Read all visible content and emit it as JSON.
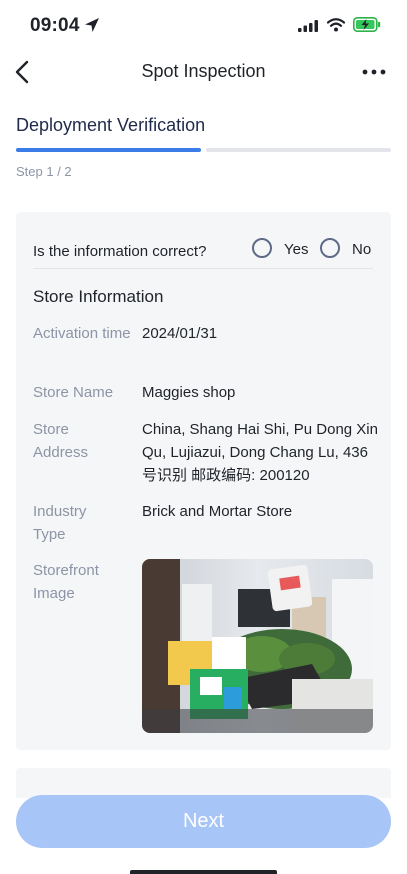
{
  "status_bar": {
    "time": "09:04",
    "icons": [
      "location-arrow-icon",
      "cellular-signal-icon",
      "wifi-icon",
      "battery-charging-icon"
    ]
  },
  "nav": {
    "title": "Spot Inspection",
    "back_icon": "chevron-left-icon",
    "more_icon": "more-horizontal-icon"
  },
  "header": {
    "title": "Deployment Verification",
    "step": "Step 1 / 2",
    "progress": {
      "current_step": 1,
      "total_steps": 2
    }
  },
  "card": {
    "question": "Is the information correct?",
    "options": [
      {
        "label": "Yes",
        "selected": false
      },
      {
        "label": "No",
        "selected": false
      }
    ],
    "section_title": "Store Information",
    "fields": [
      {
        "label": "Activation time",
        "value": "2024/01/31"
      },
      {
        "label": "Store Name",
        "value": "Maggies shop"
      },
      {
        "label": "Store Address",
        "value": "China, Shang Hai Shi, Pu Dong Xin Qu, Lujiazui, Dong Chang Lu, 436号识别 邮政编码: 200120"
      },
      {
        "label": "Industry Type",
        "value": "Brick and Mortar Store"
      }
    ],
    "image_label": "Storefront Image"
  },
  "footer": {
    "next_label": "Next"
  },
  "colors": {
    "accent": "#3b7ce8",
    "track": "#e3e5ea",
    "button_disabled": "#a8c5f7",
    "card_bg": "#f5f6f8"
  }
}
